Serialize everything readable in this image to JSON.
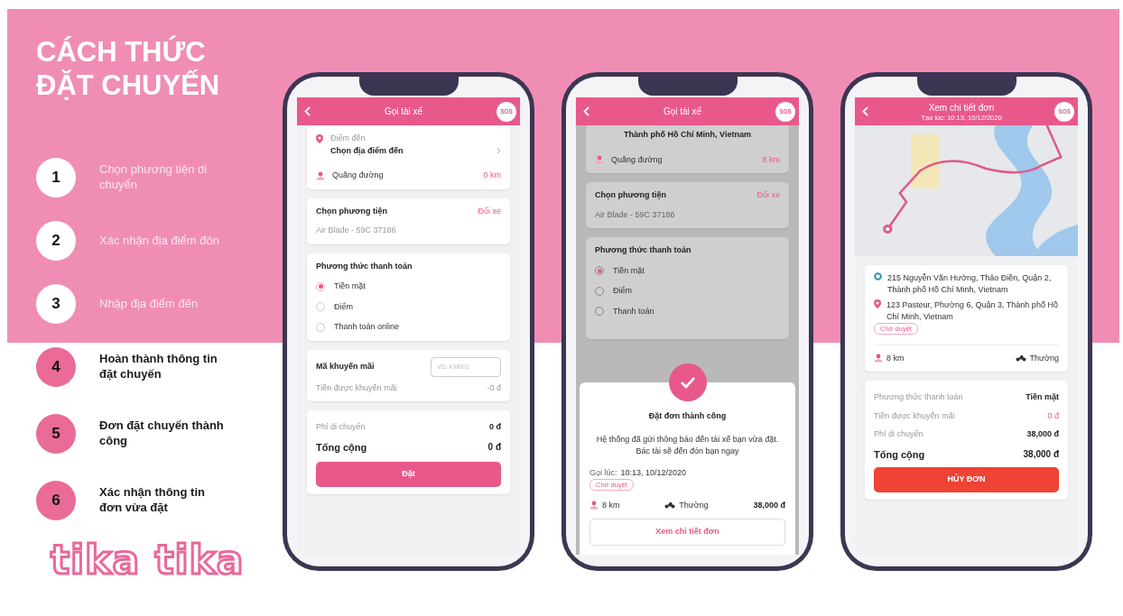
{
  "title_lines": [
    "CÁCH THỨC",
    "ĐẶT CHUYẾN"
  ],
  "steps_on_banner": [
    {
      "number": "1",
      "label": "Chọn phương tiện di chuyển"
    },
    {
      "number": "2",
      "label": "Xác nhận địa điểm đón"
    },
    {
      "number": "3",
      "label": "Nhập địa điểm đến"
    }
  ],
  "steps": [
    {
      "number": "4",
      "label": "Hoàn thành thông tin đặt chuyến"
    },
    {
      "number": "5",
      "label": "Đơn đặt chuyến thành công"
    },
    {
      "number": "6",
      "label": "Xác nhận thông tin đơn vừa đặt"
    }
  ],
  "logo": "tika tika",
  "booking_screen": {
    "header": {
      "title": "Gọi tài xế",
      "sos": "SOS"
    },
    "destination": {
      "label": "Điểm đến",
      "value": "Chọn địa điểm đến"
    },
    "distance": {
      "label": "Quãng đường",
      "value": "0 km"
    },
    "vehicle": {
      "title": "Chọn phương tiện",
      "action": "Đổi xe",
      "value": "Air Blade - 59C 37186"
    },
    "payment": {
      "title": "Phương thức thanh toán",
      "options": [
        {
          "label": "Tiền mặt",
          "selected": true
        },
        {
          "label": "Điểm",
          "selected": false
        },
        {
          "label": "Thanh toán online",
          "selected": false
        }
      ]
    },
    "promo": {
      "title": "Mã khuyến mãi",
      "placeholder": "VD: KM001",
      "discount_label": "Tiền được khuyến mãi",
      "discount_value": "-0 đ"
    },
    "totals": [
      {
        "label": "Phí di chuyển",
        "value": "0 đ",
        "kind": "strong"
      },
      {
        "label": "Tổng cộng",
        "value": "0 đ",
        "kind": "total"
      }
    ],
    "submit": "Đặt"
  },
  "success_screen": {
    "header": {
      "title": "Gọi tài xế",
      "sos": "SOS"
    },
    "address_tail": "Thành phố Hồ Chí Minh, Vietnam",
    "distance": {
      "label": "Quãng đường",
      "value": "8 km"
    },
    "vehicle": {
      "title": "Chọn phương tiện",
      "action": "Đổi xe",
      "value": "Air Blade - 59C 37186"
    },
    "payment": {
      "title": "Phương thức thanh toán",
      "options": [
        {
          "label": "Tiền mặt",
          "selected": true
        },
        {
          "label": "Điểm",
          "selected": false
        },
        {
          "label": "Thanh toán",
          "selected": false
        }
      ]
    },
    "modal": {
      "title": "Đặt đơn thành công",
      "message": "Hệ thống đã gửi thông báo đến tài xế bạn vừa đặt. Bác tài sẽ đến đón bạn ngay",
      "time_label": "Gọi lúc:",
      "time_value": "10:13, 10/12/2020",
      "status": "Chờ duyệt",
      "distance": "8 km",
      "service": "Thường",
      "price": "38,000 đ",
      "button": "Xem chi tiết đơn"
    }
  },
  "detail_screen": {
    "header": {
      "title": "Xem chi tiết đơn",
      "subtitle": "Tạo lúc: 10:13, 10/12/2020",
      "sos": "SOS"
    },
    "pickup": "215 Nguyễn Văn Hưởng, Thảo Điền, Quận 2, Thành phố Hồ Chí Minh, Vietnam",
    "dropoff": "123 Pasteur, Phường 6, Quận 3, Thành phố Hồ Chí Minh, Vietnam",
    "status": "Chờ duyệt",
    "distance": "8 km",
    "service": "Thường",
    "summary": [
      {
        "label": "Phương thức thanh toán",
        "value": "Tiền mặt",
        "kind": "strong"
      },
      {
        "label": "Tiền được khuyến mãi",
        "value": "0 đ",
        "kind": "accent"
      },
      {
        "label": "Phí di chuyển",
        "value": "38,000 đ",
        "kind": "strong"
      },
      {
        "label": "Tổng cộng",
        "value": "38,000 đ",
        "kind": "total"
      }
    ],
    "cancel": "HỦY ĐƠN"
  }
}
